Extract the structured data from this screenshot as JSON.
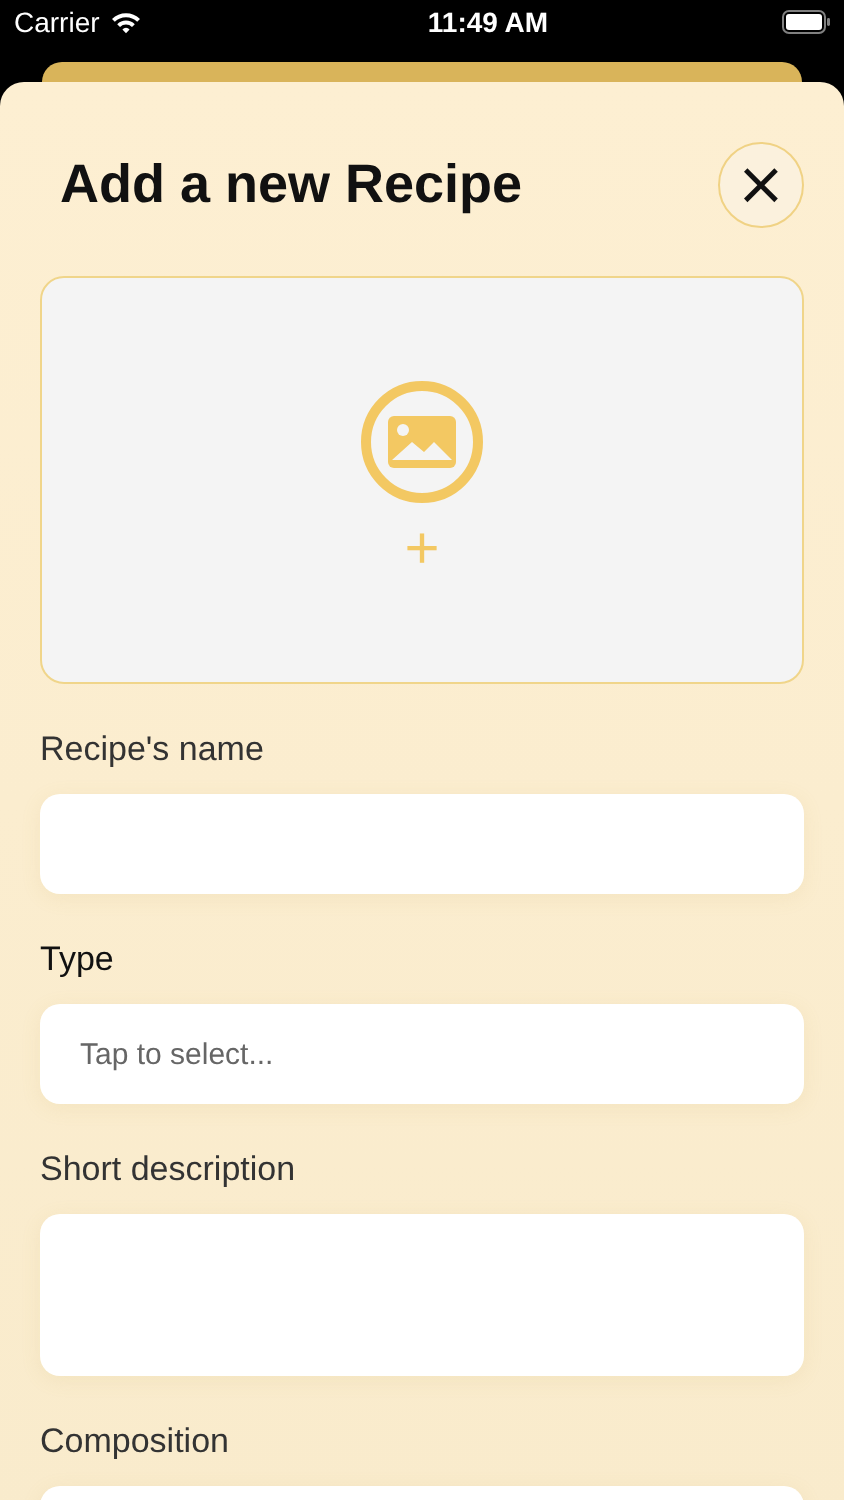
{
  "status_bar": {
    "carrier": "Carrier",
    "time": "11:49 AM"
  },
  "sheet": {
    "title": "Add a new Recipe",
    "close_label": "×"
  },
  "photo_picker": {
    "plus": "+"
  },
  "fields": [
    {
      "label": "Recipe's name",
      "kind": "text"
    },
    {
      "label": "Type",
      "kind": "select",
      "placeholder": "Tap to select..."
    },
    {
      "label": "Short description",
      "kind": "textarea"
    },
    {
      "label": "Composition",
      "kind": "text"
    }
  ]
}
